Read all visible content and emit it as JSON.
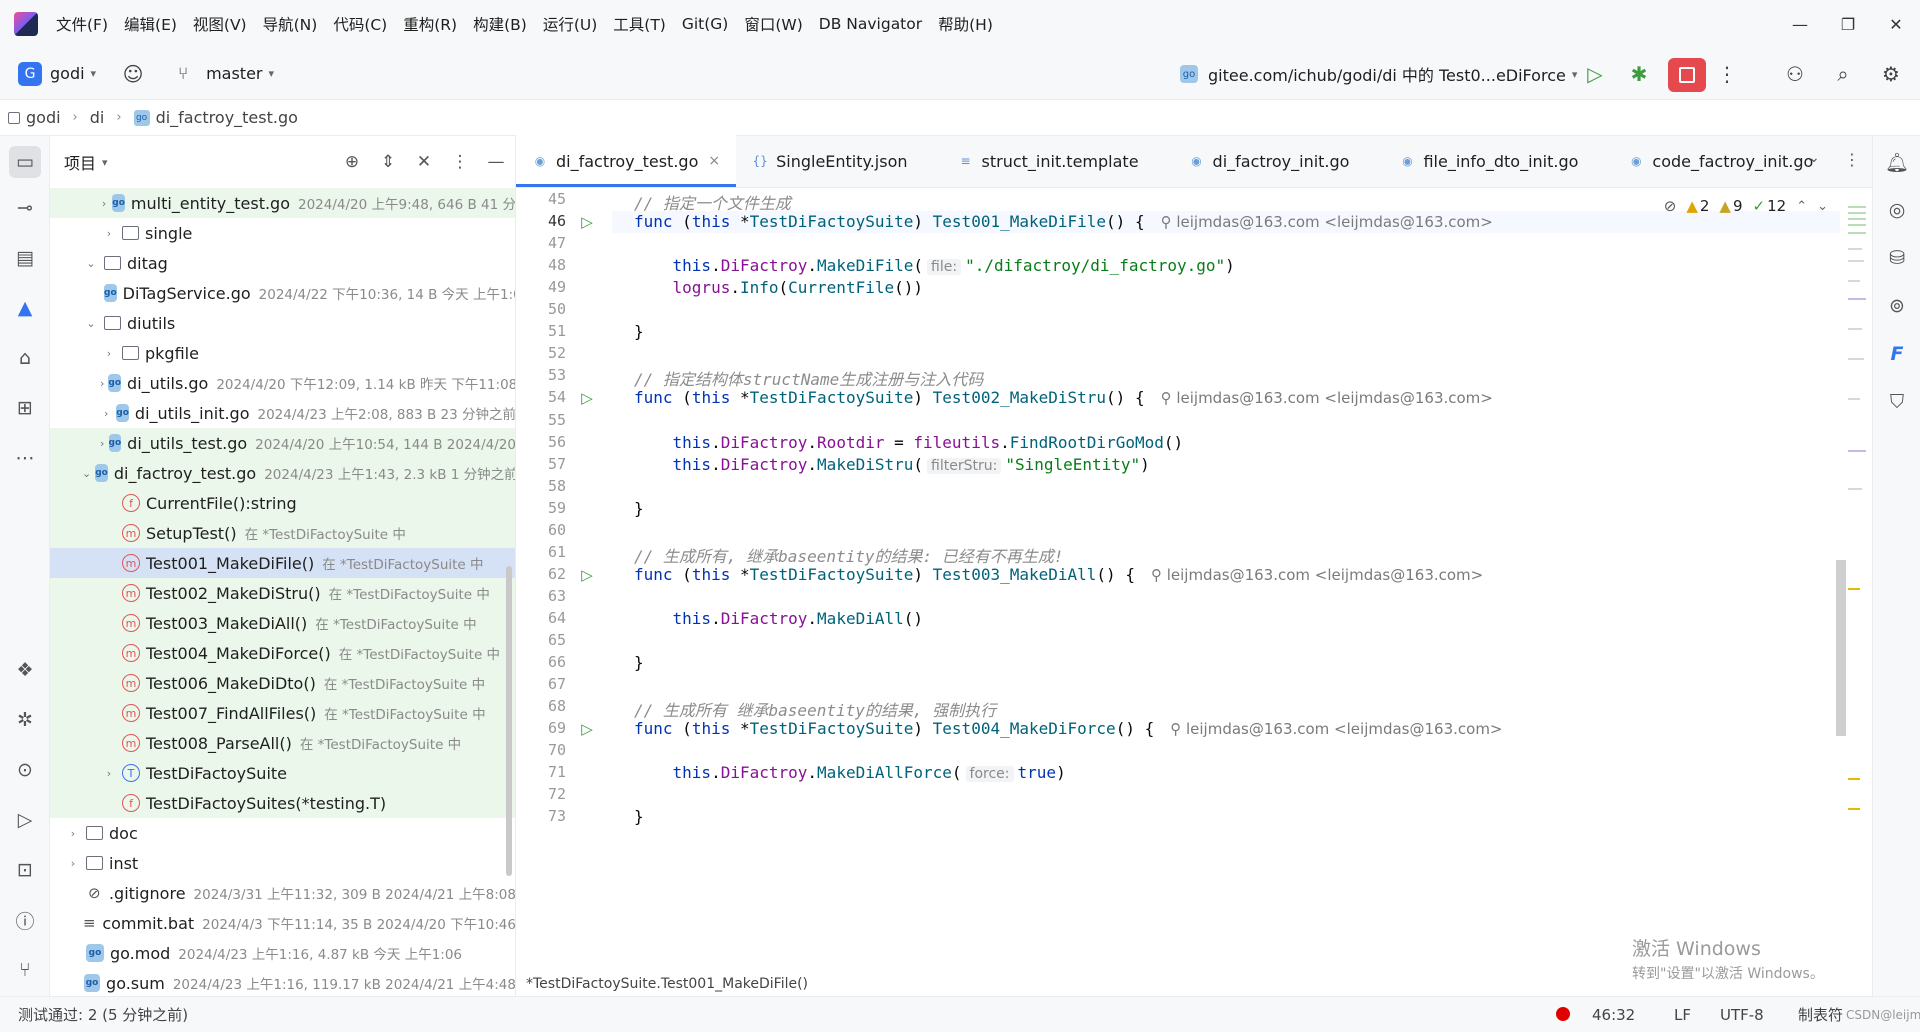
{
  "menu": [
    "文件(F)",
    "编辑(E)",
    "视图(V)",
    "导航(N)",
    "代码(C)",
    "重构(R)",
    "构建(B)",
    "运行(U)",
    "工具(T)",
    "Git(G)",
    "窗口(W)",
    "DB Navigator",
    "帮助(H)"
  ],
  "toolbar": {
    "project_badge": "G",
    "project": "godi",
    "branch": "master",
    "run_config": "gitee.com/ichub/godi/di 中的 Test0...eDiForce"
  },
  "breadcrumb": [
    "godi",
    "di",
    "di_factroy_test.go"
  ],
  "project_panel": {
    "title": "项目",
    "rows": [
      {
        "indent": 2,
        "arrow": "›",
        "icon": "go",
        "name": "multi_entity_test.go",
        "meta": "2024/4/20 上午9:48, 646 B 41 分",
        "green": true
      },
      {
        "indent": 2,
        "arrow": "›",
        "icon": "folder",
        "name": "single",
        "meta": ""
      },
      {
        "indent": 1,
        "arrow": "⌄",
        "icon": "folder",
        "name": "ditag",
        "meta": ""
      },
      {
        "indent": 2,
        "arrow": "",
        "icon": "go",
        "name": "DiTagService.go",
        "meta": "2024/4/22 下午10:36, 14 B 今天 上午1:0"
      },
      {
        "indent": 1,
        "arrow": "⌄",
        "icon": "folder",
        "name": "diutils",
        "meta": ""
      },
      {
        "indent": 2,
        "arrow": "›",
        "icon": "folder",
        "name": "pkgfile",
        "meta": ""
      },
      {
        "indent": 2,
        "arrow": "›",
        "icon": "go",
        "name": "di_utils.go",
        "meta": "2024/4/20 下午12:09, 1.14 kB 昨天 下午11:08"
      },
      {
        "indent": 2,
        "arrow": "›",
        "icon": "go",
        "name": "di_utils_init.go",
        "meta": "2024/4/23 上午2:08, 883 B 23 分钟之前"
      },
      {
        "indent": 2,
        "arrow": "›",
        "icon": "go",
        "name": "di_utils_test.go",
        "meta": "2024/4/20 上午10:54, 144 B 2024/4/20",
        "green": true
      },
      {
        "indent": 1,
        "arrow": "⌄",
        "icon": "go",
        "name": "di_factroy_test.go",
        "meta": "2024/4/23 上午1:43, 2.3 kB 1 分钟之前",
        "green": true
      },
      {
        "indent": 2,
        "arrow": "",
        "icon": "fn",
        "name": "CurrentFile():string",
        "meta": "",
        "green": true
      },
      {
        "indent": 2,
        "arrow": "",
        "icon": "m",
        "name": "SetupTest()",
        "meta": "在 *TestDiFactoySuite 中",
        "green": true
      },
      {
        "indent": 2,
        "arrow": "",
        "icon": "m",
        "name": "Test001_MakeDiFile()",
        "meta": "在 *TestDiFactoySuite 中",
        "selected": true
      },
      {
        "indent": 2,
        "arrow": "",
        "icon": "m",
        "name": "Test002_MakeDiStru()",
        "meta": "在 *TestDiFactoySuite 中",
        "green": true
      },
      {
        "indent": 2,
        "arrow": "",
        "icon": "m",
        "name": "Test003_MakeDiAll()",
        "meta": "在 *TestDiFactoySuite 中",
        "green": true
      },
      {
        "indent": 2,
        "arrow": "",
        "icon": "m",
        "name": "Test004_MakeDiForce()",
        "meta": "在 *TestDiFactoySuite 中",
        "green": true
      },
      {
        "indent": 2,
        "arrow": "",
        "icon": "m",
        "name": "Test006_MakeDiDto()",
        "meta": "在 *TestDiFactoySuite 中",
        "green": true
      },
      {
        "indent": 2,
        "arrow": "",
        "icon": "m",
        "name": "Test007_FindAllFiles()",
        "meta": "在 *TestDiFactoySuite 中",
        "green": true
      },
      {
        "indent": 2,
        "arrow": "",
        "icon": "m",
        "name": "Test008_ParseAll()",
        "meta": "在 *TestDiFactoySuite 中",
        "green": true
      },
      {
        "indent": 2,
        "arrow": "›",
        "icon": "t",
        "name": "TestDiFactoySuite",
        "meta": "",
        "green": true
      },
      {
        "indent": 2,
        "arrow": "",
        "icon": "fn",
        "name": "TestDiFactoySuites(*testing.T)",
        "meta": "",
        "green": true
      },
      {
        "indent": 0,
        "arrow": "›",
        "icon": "folder",
        "name": "doc",
        "meta": ""
      },
      {
        "indent": 0,
        "arrow": "›",
        "icon": "folder",
        "name": "inst",
        "meta": ""
      },
      {
        "indent": 0,
        "arrow": "",
        "icon": "ignore",
        "name": ".gitignore",
        "meta": "2024/3/31 上午11:32, 309 B 2024/4/21 上午8:08"
      },
      {
        "indent": 0,
        "arrow": "",
        "icon": "lines",
        "name": "commit.bat",
        "meta": "2024/4/3 下午11:14, 35 B 2024/4/20 下午10:46"
      },
      {
        "indent": 0,
        "arrow": "",
        "icon": "go",
        "name": "go.mod",
        "meta": "2024/4/23 上午1:16, 4.87 kB 今天 上午1:06"
      },
      {
        "indent": 0,
        "arrow": "",
        "icon": "go",
        "name": "go.sum",
        "meta": "2024/4/23 上午1:16, 119.17 kB 2024/4/21 上午4:48"
      }
    ]
  },
  "tabs": [
    {
      "name": "di_factroy_test.go",
      "icon": "go",
      "active": true,
      "close": "×"
    },
    {
      "name": "SingleEntity.json",
      "icon": "{}"
    },
    {
      "name": "struct_init.template",
      "icon": "≡"
    },
    {
      "name": "di_factroy_init.go",
      "icon": "go"
    },
    {
      "name": "file_info_dto_init.go",
      "icon": "go"
    },
    {
      "name": "code_factroy_init.go",
      "icon": "go"
    }
  ],
  "inspections": {
    "warn_a": "2",
    "warn_b": "9",
    "ok": "12"
  },
  "code": {
    "author": "leijmdas@163.com <leijmdas@163.com>",
    "lines": [
      {
        "n": "45",
        "t": [
          [
            "cm",
            "// 指定一个文件生成"
          ]
        ]
      },
      {
        "n": "46",
        "run": true,
        "cur": true,
        "author": true,
        "t": [
          [
            "kw",
            "func "
          ],
          [
            "",
            "("
          ],
          [
            "kw",
            "this "
          ],
          [
            "",
            "*"
          ],
          [
            "ty",
            "TestDiFactoySuite"
          ],
          [
            "",
            ") "
          ],
          [
            "mt",
            "Test001_MakeDiFile"
          ],
          [
            "",
            "() {"
          ]
        ]
      },
      {
        "n": "47",
        "t": []
      },
      {
        "n": "48",
        "t": [
          [
            "",
            "    "
          ],
          [
            "kw",
            "this"
          ],
          [
            "",
            "."
          ],
          [
            "fd",
            "DiFactroy"
          ],
          [
            "",
            "."
          ],
          [
            "mt",
            "MakeDiFile"
          ],
          [
            "",
            "("
          ],
          [
            "hint",
            "file:"
          ],
          [
            "str",
            "\"./difactroy/di_factroy.go\""
          ],
          [
            "",
            ")"
          ]
        ]
      },
      {
        "n": "49",
        "t": [
          [
            "",
            "    "
          ],
          [
            "fd",
            "logrus"
          ],
          [
            "",
            "."
          ],
          [
            "mt",
            "Info"
          ],
          [
            "",
            "("
          ],
          [
            "ty",
            "CurrentFile"
          ],
          [
            "",
            "())"
          ]
        ]
      },
      {
        "n": "50",
        "t": []
      },
      {
        "n": "51",
        "t": [
          [
            "",
            "}"
          ]
        ]
      },
      {
        "n": "52",
        "t": []
      },
      {
        "n": "53",
        "t": [
          [
            "cm",
            "// 指定结构体structName生成注册与注入代码"
          ]
        ]
      },
      {
        "n": "54",
        "run": true,
        "author": true,
        "t": [
          [
            "kw",
            "func "
          ],
          [
            "",
            "("
          ],
          [
            "kw",
            "this "
          ],
          [
            "",
            "*"
          ],
          [
            "ty",
            "TestDiFactoySuite"
          ],
          [
            "",
            ") "
          ],
          [
            "mt",
            "Test002_MakeDiStru"
          ],
          [
            "",
            "() {"
          ]
        ]
      },
      {
        "n": "55",
        "t": []
      },
      {
        "n": "56",
        "t": [
          [
            "",
            "    "
          ],
          [
            "kw",
            "this"
          ],
          [
            "",
            "."
          ],
          [
            "fd",
            "DiFactroy"
          ],
          [
            "",
            "."
          ],
          [
            "fd",
            "Rootdir"
          ],
          [
            "",
            " = "
          ],
          [
            "fd",
            "fileutils"
          ],
          [
            "",
            "."
          ],
          [
            "mt",
            "FindRootDirGoMod"
          ],
          [
            "",
            "()"
          ]
        ]
      },
      {
        "n": "57",
        "t": [
          [
            "",
            "    "
          ],
          [
            "kw",
            "this"
          ],
          [
            "",
            "."
          ],
          [
            "fd",
            "DiFactroy"
          ],
          [
            "",
            "."
          ],
          [
            "mt",
            "MakeDiStru"
          ],
          [
            "",
            "("
          ],
          [
            "hint",
            "filterStru:"
          ],
          [
            "str",
            "\"SingleEntity\""
          ],
          [
            "",
            ")"
          ]
        ]
      },
      {
        "n": "58",
        "t": []
      },
      {
        "n": "59",
        "t": [
          [
            "",
            "}"
          ]
        ]
      },
      {
        "n": "60",
        "t": []
      },
      {
        "n": "61",
        "t": [
          [
            "cm",
            "// 生成所有, 继承baseentity的结果: 已经有不再生成!"
          ]
        ]
      },
      {
        "n": "62",
        "run": true,
        "author": true,
        "t": [
          [
            "kw",
            "func "
          ],
          [
            "",
            "("
          ],
          [
            "kw",
            "this "
          ],
          [
            "",
            "*"
          ],
          [
            "ty",
            "TestDiFactoySuite"
          ],
          [
            "",
            ") "
          ],
          [
            "mt",
            "Test003_MakeDiAll"
          ],
          [
            "",
            "() {"
          ]
        ]
      },
      {
        "n": "63",
        "t": []
      },
      {
        "n": "64",
        "t": [
          [
            "",
            "    "
          ],
          [
            "kw",
            "this"
          ],
          [
            "",
            "."
          ],
          [
            "fd",
            "DiFactroy"
          ],
          [
            "",
            "."
          ],
          [
            "mt",
            "MakeDiAll"
          ],
          [
            "",
            "()"
          ]
        ]
      },
      {
        "n": "65",
        "t": []
      },
      {
        "n": "66",
        "t": [
          [
            "",
            "}"
          ]
        ]
      },
      {
        "n": "67",
        "t": []
      },
      {
        "n": "68",
        "t": [
          [
            "cm",
            "// 生成所有 继承baseentity的结果, 强制执行"
          ]
        ]
      },
      {
        "n": "69",
        "run": true,
        "author": true,
        "t": [
          [
            "kw",
            "func "
          ],
          [
            "",
            "("
          ],
          [
            "kw",
            "this "
          ],
          [
            "",
            "*"
          ],
          [
            "ty",
            "TestDiFactoySuite"
          ],
          [
            "",
            ") "
          ],
          [
            "mt",
            "Test004_MakeDiForce"
          ],
          [
            "",
            "() {"
          ]
        ]
      },
      {
        "n": "70",
        "t": []
      },
      {
        "n": "71",
        "t": [
          [
            "",
            "    "
          ],
          [
            "kw",
            "this"
          ],
          [
            "",
            "."
          ],
          [
            "fd",
            "DiFactroy"
          ],
          [
            "",
            "."
          ],
          [
            "mt",
            "MakeDiAllForce"
          ],
          [
            "",
            "("
          ],
          [
            "hint",
            "force:"
          ],
          [
            "kw",
            "true"
          ],
          [
            "",
            ")"
          ]
        ]
      },
      {
        "n": "72",
        "t": []
      },
      {
        "n": "73",
        "t": [
          [
            "",
            "}"
          ]
        ]
      }
    ]
  },
  "editor_footer": "*TestDiFactoySuite.Test001_MakeDiFile()",
  "watermark": {
    "title": "激活 Windows",
    "sub": "转到\"设置\"以激活 Windows。"
  },
  "status": {
    "left": "测试通过: 2 (5 分钟之前)",
    "position": "46:32",
    "line_sep": "LF",
    "encoding": "UTF-8",
    "indent": "制表符",
    "extra": "CSDN@leijmdas"
  },
  "colors": {
    "accent": "#3574f0",
    "run": "#3e9b3e",
    "stop": "#e5484d",
    "green_row": "#eaf7ea"
  }
}
